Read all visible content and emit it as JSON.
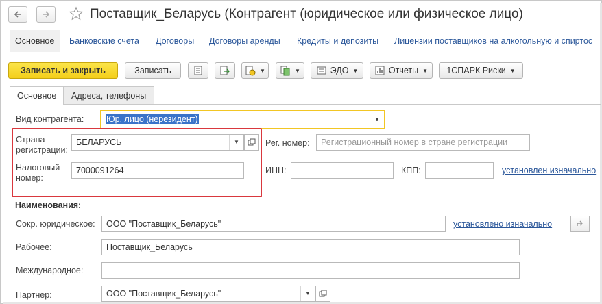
{
  "window": {
    "title": "Поставщик_Беларусь (Контрагент (юридическое или физическое лицо)"
  },
  "sections": {
    "active": "Основное",
    "links": [
      "Банковские счета",
      "Договоры",
      "Договоры аренды",
      "Кредиты и депозиты",
      "Лицензии поставщиков на алкогольную и спиртос"
    ]
  },
  "toolbar": {
    "save_close": "Записать и закрыть",
    "save": "Записать",
    "edo": "ЭДО",
    "reports": "Отчеты",
    "spark": "1СПАРК Риски"
  },
  "tabs": [
    "Основное",
    "Адреса, телефоны"
  ],
  "form": {
    "kind_label": "Вид контрагента:",
    "kind_value": "Юр. лицо (нерезидент)",
    "country_label": "Страна регистрации:",
    "country_value": "БЕЛАРУСЬ",
    "reg_label": "Рег. номер:",
    "reg_placeholder": "Регистрационный номер в стране регистрации",
    "tax_label": "Налоговый номер:",
    "tax_value": "7000091264",
    "inn_label": "ИНН:",
    "kpp_label": "КПП:",
    "inn_status_link": "установлен изначально",
    "names_header": "Наименования:",
    "short_label": "Сокр. юридическое:",
    "short_value": "ООО \"Поставщик_Беларусь\"",
    "short_status_link": "установлено изначально",
    "work_label": "Рабочее:",
    "work_value": "Поставщик_Беларусь",
    "intl_label": "Международное:",
    "intl_value": "",
    "partner_label": "Партнер:",
    "partner_value": "ООО \"Поставщик_Беларусь\""
  },
  "colors": {
    "primary_button": "#f4cf1a",
    "link": "#2b579a",
    "highlight_box": "#d9383e",
    "focus_border": "#f2c624"
  }
}
